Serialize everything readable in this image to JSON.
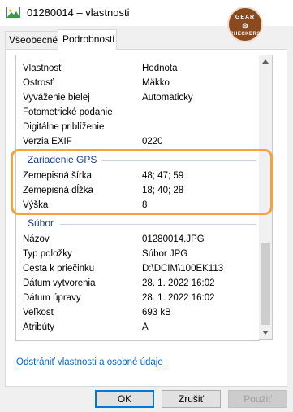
{
  "window": {
    "title": "01280014 – vlastnosti"
  },
  "badge": {
    "line1": "GEAR",
    "line2": "",
    "line3": "CHECKERS"
  },
  "tabs": [
    {
      "label": "Všeobecné",
      "active": false
    },
    {
      "label": "Podrobnosti",
      "active": true
    }
  ],
  "table": {
    "header_key": "Vlastnosť",
    "header_value": "Hodnota",
    "rows_camera": [
      {
        "key": "Ostrosť",
        "value": "Mäkko"
      },
      {
        "key": "Vyváženie bielej",
        "value": "Automaticky"
      },
      {
        "key": "Fotometrické podanie",
        "value": ""
      },
      {
        "key": "Digitálne priblíženie",
        "value": ""
      },
      {
        "key": "Verzia EXIF",
        "value": "0220"
      }
    ],
    "section_gps": "Zariadenie GPS",
    "rows_gps": [
      {
        "key": "Zemepisná šírka",
        "value": "48; 47; 59"
      },
      {
        "key": "Zemepisná dĺžka",
        "value": "18; 40; 28"
      },
      {
        "key": "Výška",
        "value": "8"
      }
    ],
    "section_file": "Súbor",
    "rows_file": [
      {
        "key": "Názov",
        "value": "01280014.JPG"
      },
      {
        "key": "Typ položky",
        "value": "Súbor JPG"
      },
      {
        "key": "Cesta k priečinku",
        "value": "D:\\DCIM\\100EK113"
      },
      {
        "key": "Dátum vytvorenia",
        "value": "28. 1. 2022 16:02"
      },
      {
        "key": "Dátum úpravy",
        "value": "28. 1. 2022 16:02"
      },
      {
        "key": "Veľkosť",
        "value": "693 kB"
      },
      {
        "key": "Atribúty",
        "value": "A"
      }
    ]
  },
  "link": "Odstrániť vlastnosti a osobné údaje",
  "buttons": {
    "ok": "OK",
    "cancel": "Zrušiť",
    "apply": "Použiť"
  },
  "colors": {
    "highlight": "#f4a23c",
    "section": "#1a3d8c",
    "link": "#0066cc",
    "ok_border": "#0078d7"
  }
}
